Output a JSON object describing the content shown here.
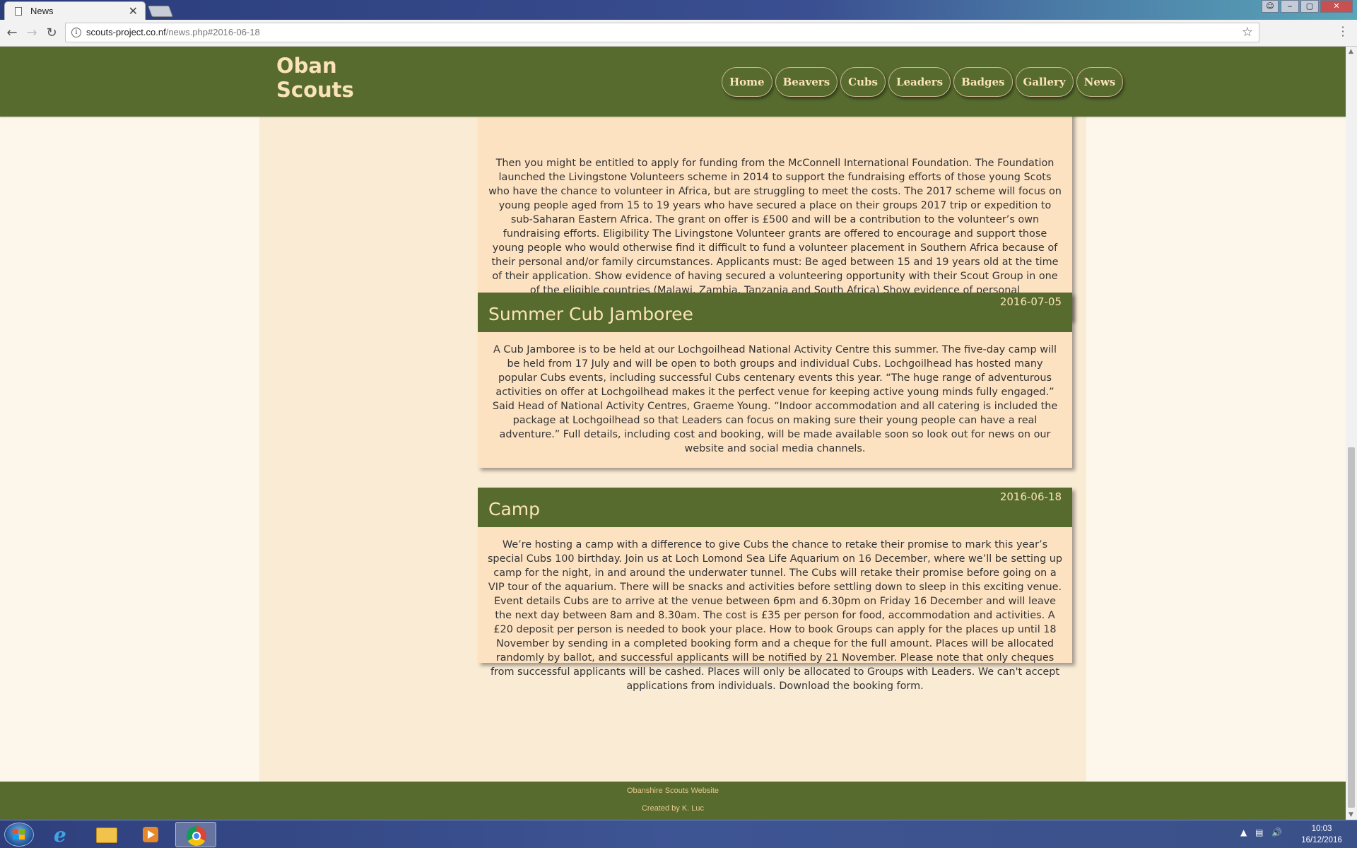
{
  "browser": {
    "tab_title": "News",
    "tab_close": "✕",
    "url_host": "scouts-project.co.nf",
    "url_path": "/news.php#2016-06-18",
    "window_controls": {
      "minimize": "‒",
      "maximize": "▢",
      "close": "✕"
    }
  },
  "site": {
    "logo_line1": "Oban",
    "logo_line2": "Scouts",
    "nav": [
      "Home",
      "Beavers",
      "Cubs",
      "Leaders",
      "Badges",
      "Gallery",
      "News"
    ]
  },
  "articles": [
    {
      "title": "",
      "date": "",
      "body": "Then you might be entitled to apply for funding from the McConnell International Foundation. The Foundation launched the Livingstone Volunteers scheme in 2014 to support the fundraising efforts of those young Scots who have the chance to volunteer in Africa, but are struggling to meet the costs. The 2017 scheme will focus on young people aged from 15 to 19 years who have secured a place on their groups 2017 trip or expedition to sub-Saharan Eastern Africa. The grant on offer is £500 and will be a contribution to the volunteer’s own fundraising efforts. Eligibility The Livingstone Volunteer grants are offered to encourage and support those young people who would otherwise find it difficult to fund a volunteer placement in Southern Africa because of their personal and/or family circumstances. Applicants must: Be aged between 15 and 19 years old at the time of their application. Show evidence of having secured a volunteering opportunity with their Scout Group in one of the eligible countries (Malawi, Zambia, Tanzania and South Africa) Show evidence of personal challenge/difficult circumstances, i.e. be from a low-income household, have been in care or are a young carer, or live with a disability."
    },
    {
      "title": "Summer Cub Jamboree",
      "date": "2016-07-05",
      "body": "A Cub Jamboree is to be held at our Lochgoilhead National Activity Centre this summer. The five-day camp will be held from 17 July and will be open to both groups and individual Cubs. Lochgoilhead has hosted many popular Cubs events, including successful Cubs centenary events this year. “The huge range of adventurous activities on offer at Lochgoilhead makes it the perfect venue for keeping active young minds fully engaged.” Said Head of National Activity Centres, Graeme Young. “Indoor accommodation and all catering is included the package at Lochgoilhead so that Leaders can focus on making sure their young people can have a real adventure.” Full details, including cost and booking, will be made available soon so look out for news on our website and social media channels."
    },
    {
      "title": "Camp",
      "date": "2016-06-18",
      "body": "We’re hosting a camp with a difference to give Cubs the chance to retake their promise to mark this year’s special Cubs 100 birthday. Join us at Loch Lomond Sea Life Aquarium on 16 December, where we’ll be setting up camp for the night, in and around the underwater tunnel. The Cubs will retake their promise before going on a VIP tour of the aquarium. There will be snacks and activities before settling down to sleep in this exciting venue. Event details Cubs are to arrive at the venue between 6pm and 6.30pm on Friday 16 December and will leave the next day between 8am and 8.30am. The cost is £35 per person for food, accommodation and activities. A £20 deposit per person is needed to book your place. How to book Groups can apply for the places up until 18 November by sending in a completed booking form and a cheque for the full amount. Places will be allocated randomly by ballot, and successful applicants will be notified by 21 November. Please note that only cheques from successful applicants will be cashed. Places will only be allocated to Groups with Leaders. We can't accept applications from individuals. Download the booking form."
    }
  ],
  "footer": {
    "line1": "Obanshire Scouts Website",
    "line2": "Created by K. Luc"
  },
  "taskbar": {
    "time": "10:03",
    "date": "16/12/2016"
  },
  "colors": {
    "brand_green": "#576b2e",
    "brand_cream": "#fbe3b9",
    "article_bg": "#fde2c2",
    "page_bg": "#faebd5"
  }
}
